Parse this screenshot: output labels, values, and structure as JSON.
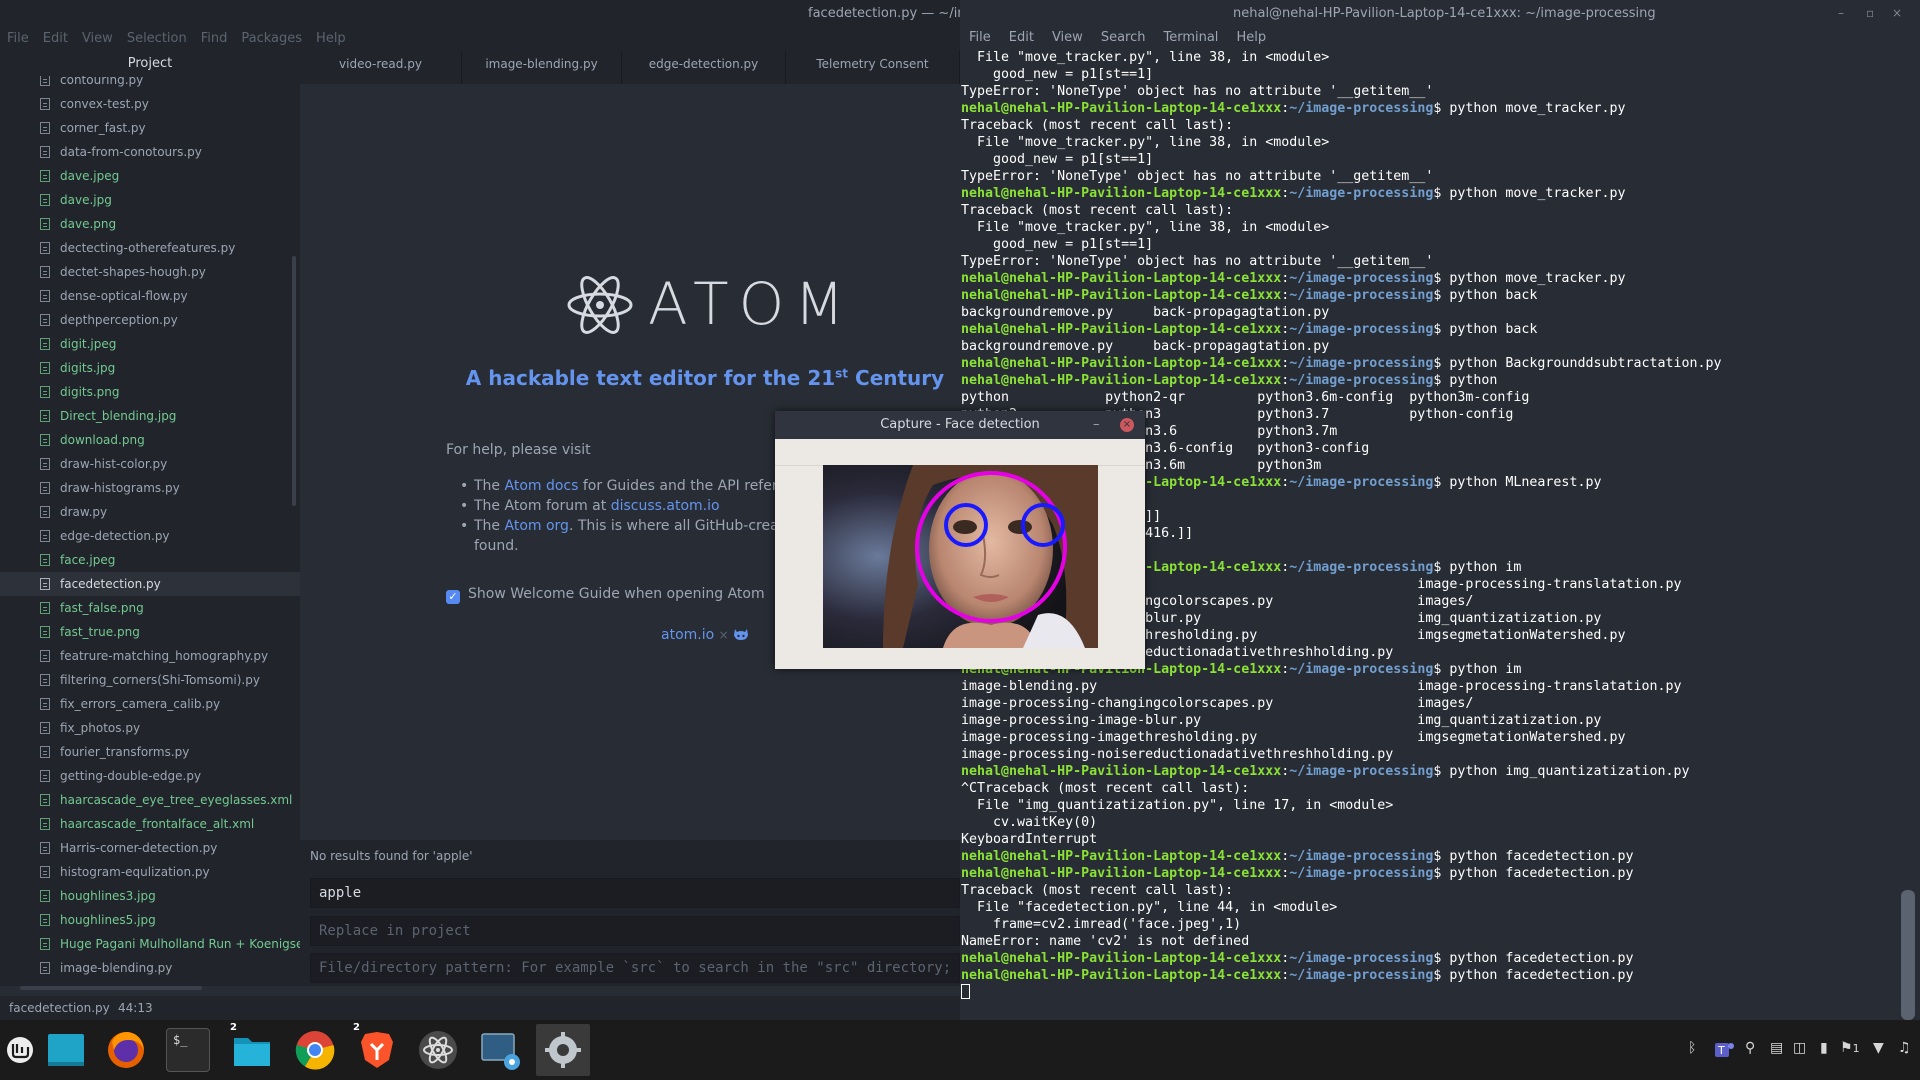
{
  "atom": {
    "title": "facedetection.py — ~/im",
    "menu": [
      "File",
      "Edit",
      "View",
      "Selection",
      "Find",
      "Packages",
      "Help"
    ],
    "tree_header": "Project",
    "tree": [
      {
        "name": "contouring.py",
        "green": false
      },
      {
        "name": "convex-test.py",
        "green": false
      },
      {
        "name": "corner_fast.py",
        "green": false
      },
      {
        "name": "data-from-conotours.py",
        "green": false
      },
      {
        "name": "dave.jpeg",
        "green": true
      },
      {
        "name": "dave.jpg",
        "green": true
      },
      {
        "name": "dave.png",
        "green": true
      },
      {
        "name": "dectecting-otherefeatures.py",
        "green": false
      },
      {
        "name": "dectet-shapes-hough.py",
        "green": false
      },
      {
        "name": "dense-optical-flow.py",
        "green": false
      },
      {
        "name": "depthperception.py",
        "green": false
      },
      {
        "name": "digit.jpeg",
        "green": true
      },
      {
        "name": "digits.jpg",
        "green": true
      },
      {
        "name": "digits.png",
        "green": true
      },
      {
        "name": "Direct_blending.jpg",
        "green": true
      },
      {
        "name": "download.png",
        "green": true
      },
      {
        "name": "draw-hist-color.py",
        "green": false
      },
      {
        "name": "draw-histograms.py",
        "green": false
      },
      {
        "name": "draw.py",
        "green": false
      },
      {
        "name": "edge-detection.py",
        "green": false
      },
      {
        "name": "face.jpeg",
        "green": true
      },
      {
        "name": "facedetection.py",
        "green": true,
        "selected": true
      },
      {
        "name": "fast_false.png",
        "green": true
      },
      {
        "name": "fast_true.png",
        "green": true
      },
      {
        "name": "featrure-matching_homography.py",
        "green": false
      },
      {
        "name": "filtering_corners(Shi-Tomsomi).py",
        "green": false
      },
      {
        "name": "fix_errors_camera_calib.py",
        "green": false
      },
      {
        "name": "fix_photos.py",
        "green": false
      },
      {
        "name": "fourier_transforms.py",
        "green": false
      },
      {
        "name": "getting-double-edge.py",
        "green": false
      },
      {
        "name": "haarcascade_eye_tree_eyeglasses.xml",
        "green": true
      },
      {
        "name": "haarcascade_frontalface_alt.xml",
        "green": true
      },
      {
        "name": "Harris-corner-detection.py",
        "green": false
      },
      {
        "name": "histogram-equlization.py",
        "green": false
      },
      {
        "name": "houghlines3.jpg",
        "green": true
      },
      {
        "name": "houghlines5.jpg",
        "green": true
      },
      {
        "name": "Huge Pagani Mulholland Run + Koenigsegg",
        "green": true
      },
      {
        "name": "image-blending.py",
        "green": false
      }
    ],
    "tabs": [
      "video-read.py",
      "image-blending.py",
      "edge-detection.py",
      "Telemetry Consent"
    ],
    "welcome": {
      "logo_text": "ATOM",
      "tagline_pre": "A hackable text editor for the 21",
      "tagline_sup": "st",
      "tagline_post": " Century",
      "help_intro": "For help, please visit",
      "item1_pre": "The ",
      "item1_link": "Atom docs",
      "item1_post": " for Guides and the API refere",
      "item2_pre": "The Atom forum at ",
      "item2_link": "discuss.atom.io",
      "item3_pre": "The ",
      "item3_link": "Atom org",
      "item3_post": ". This is where all GitHub-creat",
      "item3_line2": "found.",
      "show_guide": "Show Welcome Guide when opening Atom",
      "footer_link": "atom.io",
      "footer_sep": "×"
    },
    "find": {
      "message": "No results found for 'apple'",
      "query": "apple",
      "replace_placeholder": "Replace in project",
      "pattern_placeholder": "File/directory pattern: For example `src` to search in the \"src\" directory; `"
    },
    "status": {
      "file": "facedetection.py",
      "position": "44:13"
    }
  },
  "terminal": {
    "title": "nehal@nehal-HP-Pavilion-Laptop-14-ce1xxx: ~/image-processing",
    "menu": [
      "File",
      "Edit",
      "View",
      "Search",
      "Terminal",
      "Help"
    ],
    "user": "nehal@nehal-HP-Pavilion-Laptop-14-ce1xxx",
    "path": "~/image-processing",
    "lines": [
      {
        "t": "  File \"move_tracker.py\", line 38, in <module>"
      },
      {
        "t": "    good_new = p1[st==1]"
      },
      {
        "t": "TypeError: 'NoneType' object has no attribute '__getitem__'"
      },
      {
        "cmd": "python move_tracker.py"
      },
      {
        "t": "Traceback (most recent call last):"
      },
      {
        "t": "  File \"move_tracker.py\", line 38, in <module>"
      },
      {
        "t": "    good_new = p1[st==1]"
      },
      {
        "t": "TypeError: 'NoneType' object has no attribute '__getitem__'"
      },
      {
        "cmd": "python move_tracker.py"
      },
      {
        "t": "Traceback (most recent call last):"
      },
      {
        "t": "  File \"move_tracker.py\", line 38, in <module>"
      },
      {
        "t": "    good_new = p1[st==1]"
      },
      {
        "t": "TypeError: 'NoneType' object has no attribute '__getitem__'"
      },
      {
        "cmd": "python move_tracker.py"
      },
      {
        "cmd": "python back"
      },
      {
        "t": "backgroundremove.py     back-propagagtation.py"
      },
      {
        "cmd": "python back"
      },
      {
        "t": "backgroundremove.py     back-propagagtation.py"
      },
      {
        "cmd": "python Backgrounddsubtractation.py"
      },
      {
        "cmd": "python"
      },
      {
        "t": "python            python2-qr         python3.6m-config  python3m-config"
      },
      {
        "t": "python2           python3            python3.7          python-config"
      },
      {
        "t": "python2.7         python3.6          python3.7m"
      },
      {
        "t": "python2.7-config  python3.6-config   python3-config"
      },
      {
        "t": "python2-config    python3.6m         python3m"
      },
      {
        "cmd": "python MLnearest.py"
      },
      {
        "t": "result:  [[1.]]"
      },
      {
        "t": "neighbours:  [[1. 0. 0.]]"
      },
      {
        "t": "distance:  [[305. 389. 416.]]"
      },
      {
        "t": ""
      },
      {
        "cmd": "python im"
      },
      {
        "t": "image-blending.py                                        image-processing-translatation.py"
      },
      {
        "t": "image-processing-changingcolorscapes.py                  images/"
      },
      {
        "t": "image-processing-image-blur.py                           img_quantizatization.py"
      },
      {
        "t": "image-processing-imagethresholding.py                    imgsegmetationWatershed.py"
      },
      {
        "t": "image-processing-noisereductionadativethreshholding.py"
      },
      {
        "cmd": "python im"
      },
      {
        "t": "image-blending.py                                        image-processing-translatation.py"
      },
      {
        "t": "image-processing-changingcolorscapes.py                  images/"
      },
      {
        "t": "image-processing-image-blur.py                           img_quantizatization.py"
      },
      {
        "t": "image-processing-imagethresholding.py                    imgsegmetationWatershed.py"
      },
      {
        "t": "image-processing-noisereductionadativethreshholding.py"
      },
      {
        "cmd": "python img_quantizatization.py"
      },
      {
        "t": "^CTraceback (most recent call last):"
      },
      {
        "t": "  File \"img_quantizatization.py\", line 17, in <module>"
      },
      {
        "t": "    cv.waitKey(0)"
      },
      {
        "t": "KeyboardInterrupt"
      },
      {
        "cmd": "python facedetection.py"
      },
      {
        "cmd": "python facedetection.py"
      },
      {
        "t": "Traceback (most recent call last):"
      },
      {
        "t": "  File \"facedetection.py\", line 44, in <module>"
      },
      {
        "t": "    frame=cv2.imread('face.jpeg',1)"
      },
      {
        "t": "NameError: name 'cv2' is not defined"
      },
      {
        "cmd": "python facedetection.py"
      },
      {
        "cmd": "python facedetection.py"
      },
      {
        "cursor": true
      }
    ]
  },
  "face_window": {
    "title": "Capture - Face detection",
    "minimize": "–",
    "close": "×"
  },
  "taskbar": {
    "apps": [
      "menu-icon",
      "show-desktop-icon",
      "firefox-icon",
      "terminal-icon",
      "files-icon",
      "chrome-icon",
      "brave-icon",
      "atom-icon",
      "screenshot-icon",
      "capture-window-icon"
    ],
    "files_badge": "2",
    "brave_badge": "2",
    "terminal_glyph": "$_",
    "tray_count": "1"
  },
  "colors": {
    "prompt_user": "#8ae234",
    "prompt_path": "#729fcf",
    "atom_link": "#6494ed",
    "face_circle": "#e600e6",
    "eye_circle": "#1a1aff"
  }
}
